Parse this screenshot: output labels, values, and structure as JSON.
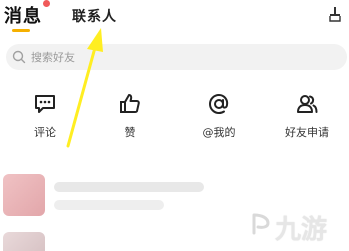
{
  "tabs": {
    "messages_label": "消息",
    "contacts_label": "联系人",
    "accent_color": "#f5b000",
    "badge_color": "#f05a5a"
  },
  "search": {
    "placeholder": "搜索好友"
  },
  "actions": [
    {
      "label": "评论",
      "icon": "comment-icon"
    },
    {
      "label": "赞",
      "icon": "thumbs-up-icon"
    },
    {
      "label": "@我的",
      "icon": "at-icon"
    },
    {
      "label": "好友申请",
      "icon": "friend-request-icon"
    }
  ],
  "annotation": {
    "arrow_color": "#ffee22"
  },
  "watermark": {
    "text": "九游"
  }
}
